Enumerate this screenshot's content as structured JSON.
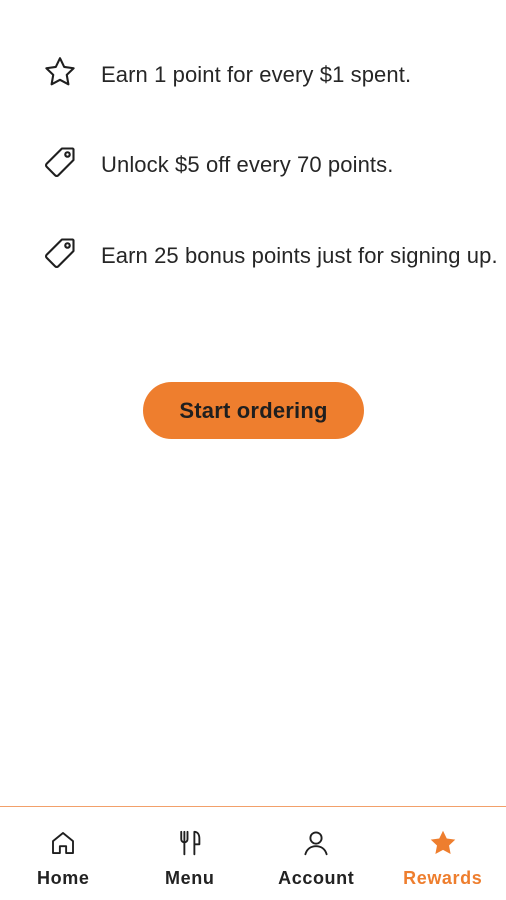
{
  "colors": {
    "accent": "#ee7e2e",
    "text": "#262626",
    "tab_border": "#f2a06a"
  },
  "benefits": [
    {
      "icon": "star-outline-icon",
      "text": "Earn 1 point for every $1 spent."
    },
    {
      "icon": "tag-icon",
      "text": "Unlock $5 off every 70 points."
    },
    {
      "icon": "tag-icon",
      "text": "Earn 25 bonus points just for signing up."
    }
  ],
  "cta": {
    "label": "Start ordering"
  },
  "tabbar": {
    "active": "Rewards",
    "tabs": [
      {
        "label": "Home",
        "icon": "home-icon"
      },
      {
        "label": "Menu",
        "icon": "fork-knife-icon"
      },
      {
        "label": "Account",
        "icon": "person-icon"
      },
      {
        "label": "Rewards",
        "icon": "star-filled-icon"
      }
    ]
  }
}
